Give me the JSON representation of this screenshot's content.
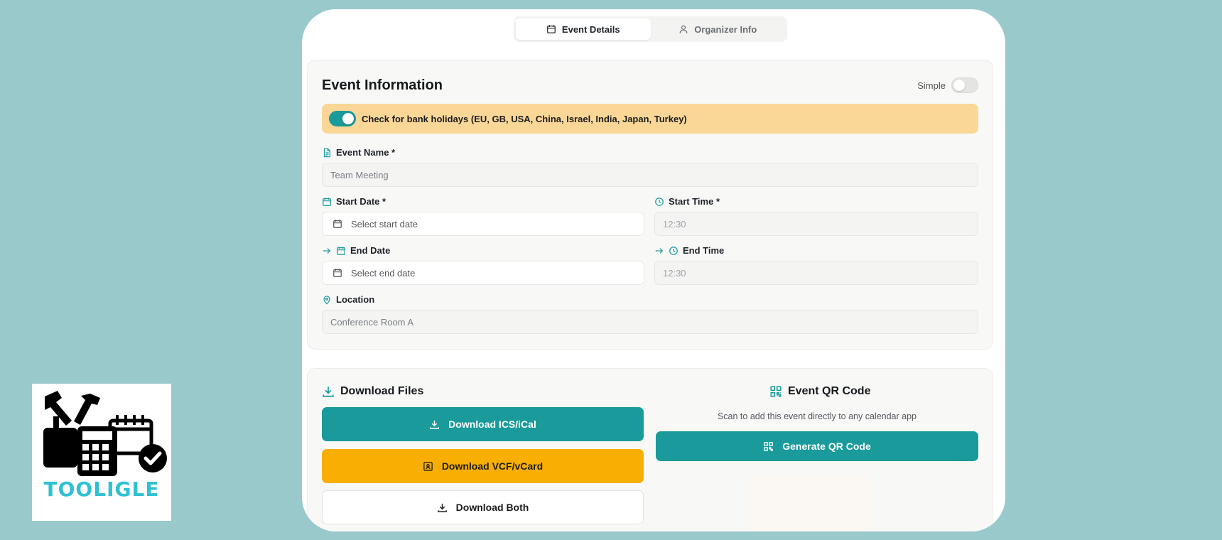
{
  "tabs": [
    {
      "label": "Event Details",
      "icon": "calendar-icon",
      "active": true
    },
    {
      "label": "Organizer Info",
      "icon": "user-icon",
      "active": false
    }
  ],
  "event_card": {
    "title": "Event Information",
    "simple_label": "Simple",
    "simple_on": false,
    "holiday_label": "Check for bank holidays (EU, GB, USA, China, Israel, India, Japan, Turkey)",
    "holiday_on": true,
    "event_name": {
      "label": "Event Name *",
      "placeholder": "Team Meeting"
    },
    "start_date": {
      "label": "Start Date *",
      "placeholder": "Select start date"
    },
    "start_time": {
      "label": "Start Time *",
      "placeholder": "12:30"
    },
    "end_date": {
      "label": "End Date",
      "placeholder": "Select end date"
    },
    "end_time": {
      "label": "End Time",
      "placeholder": "12:30"
    },
    "location": {
      "label": "Location",
      "placeholder": "Conference Room A"
    }
  },
  "downloads": {
    "title": "Download Files",
    "ics_label": "Download ICS/iCal",
    "vcf_label": "Download VCF/vCard",
    "both_label": "Download Both"
  },
  "qr": {
    "title": "Event QR Code",
    "description": "Scan to add this event directly to any calendar app",
    "button_label": "Generate QR Code"
  },
  "logo": {
    "text": "TOOLIGLE"
  },
  "colors": {
    "accent": "#1a9a9a",
    "amber": "#f8ae02",
    "background": "#99c9cb",
    "holiday_banner": "#fad797"
  }
}
